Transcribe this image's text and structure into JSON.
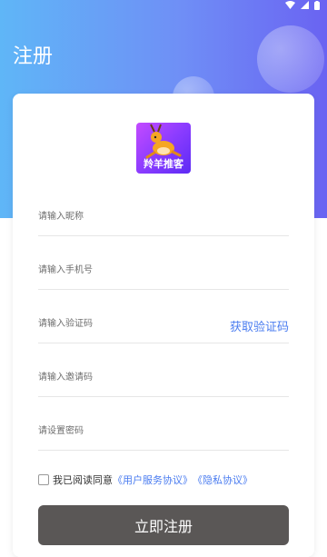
{
  "header": {
    "title": "注册"
  },
  "logo": {
    "app_name": "羚羊推客"
  },
  "form": {
    "nickname_placeholder": "请输入昵称",
    "phone_placeholder": "请输入手机号",
    "code_placeholder": "请输入验证码",
    "get_code_label": "获取验证码",
    "invite_placeholder": "请输入邀请码",
    "password_placeholder": "请设置密码"
  },
  "agreement": {
    "prefix": "我已阅读同意",
    "user_agreement": "《用户服务协议》",
    "privacy_agreement": "《隐私协议》",
    "checked": false
  },
  "submit_label": "立即注册",
  "colors": {
    "accent": "#4a7cf0",
    "button_bg": "#5a5756",
    "header_gradient_start": "#5fb6f7",
    "header_gradient_end": "#6a63f2"
  },
  "status_icons": [
    "wifi-icon",
    "signal-icon",
    "battery-icon"
  ]
}
